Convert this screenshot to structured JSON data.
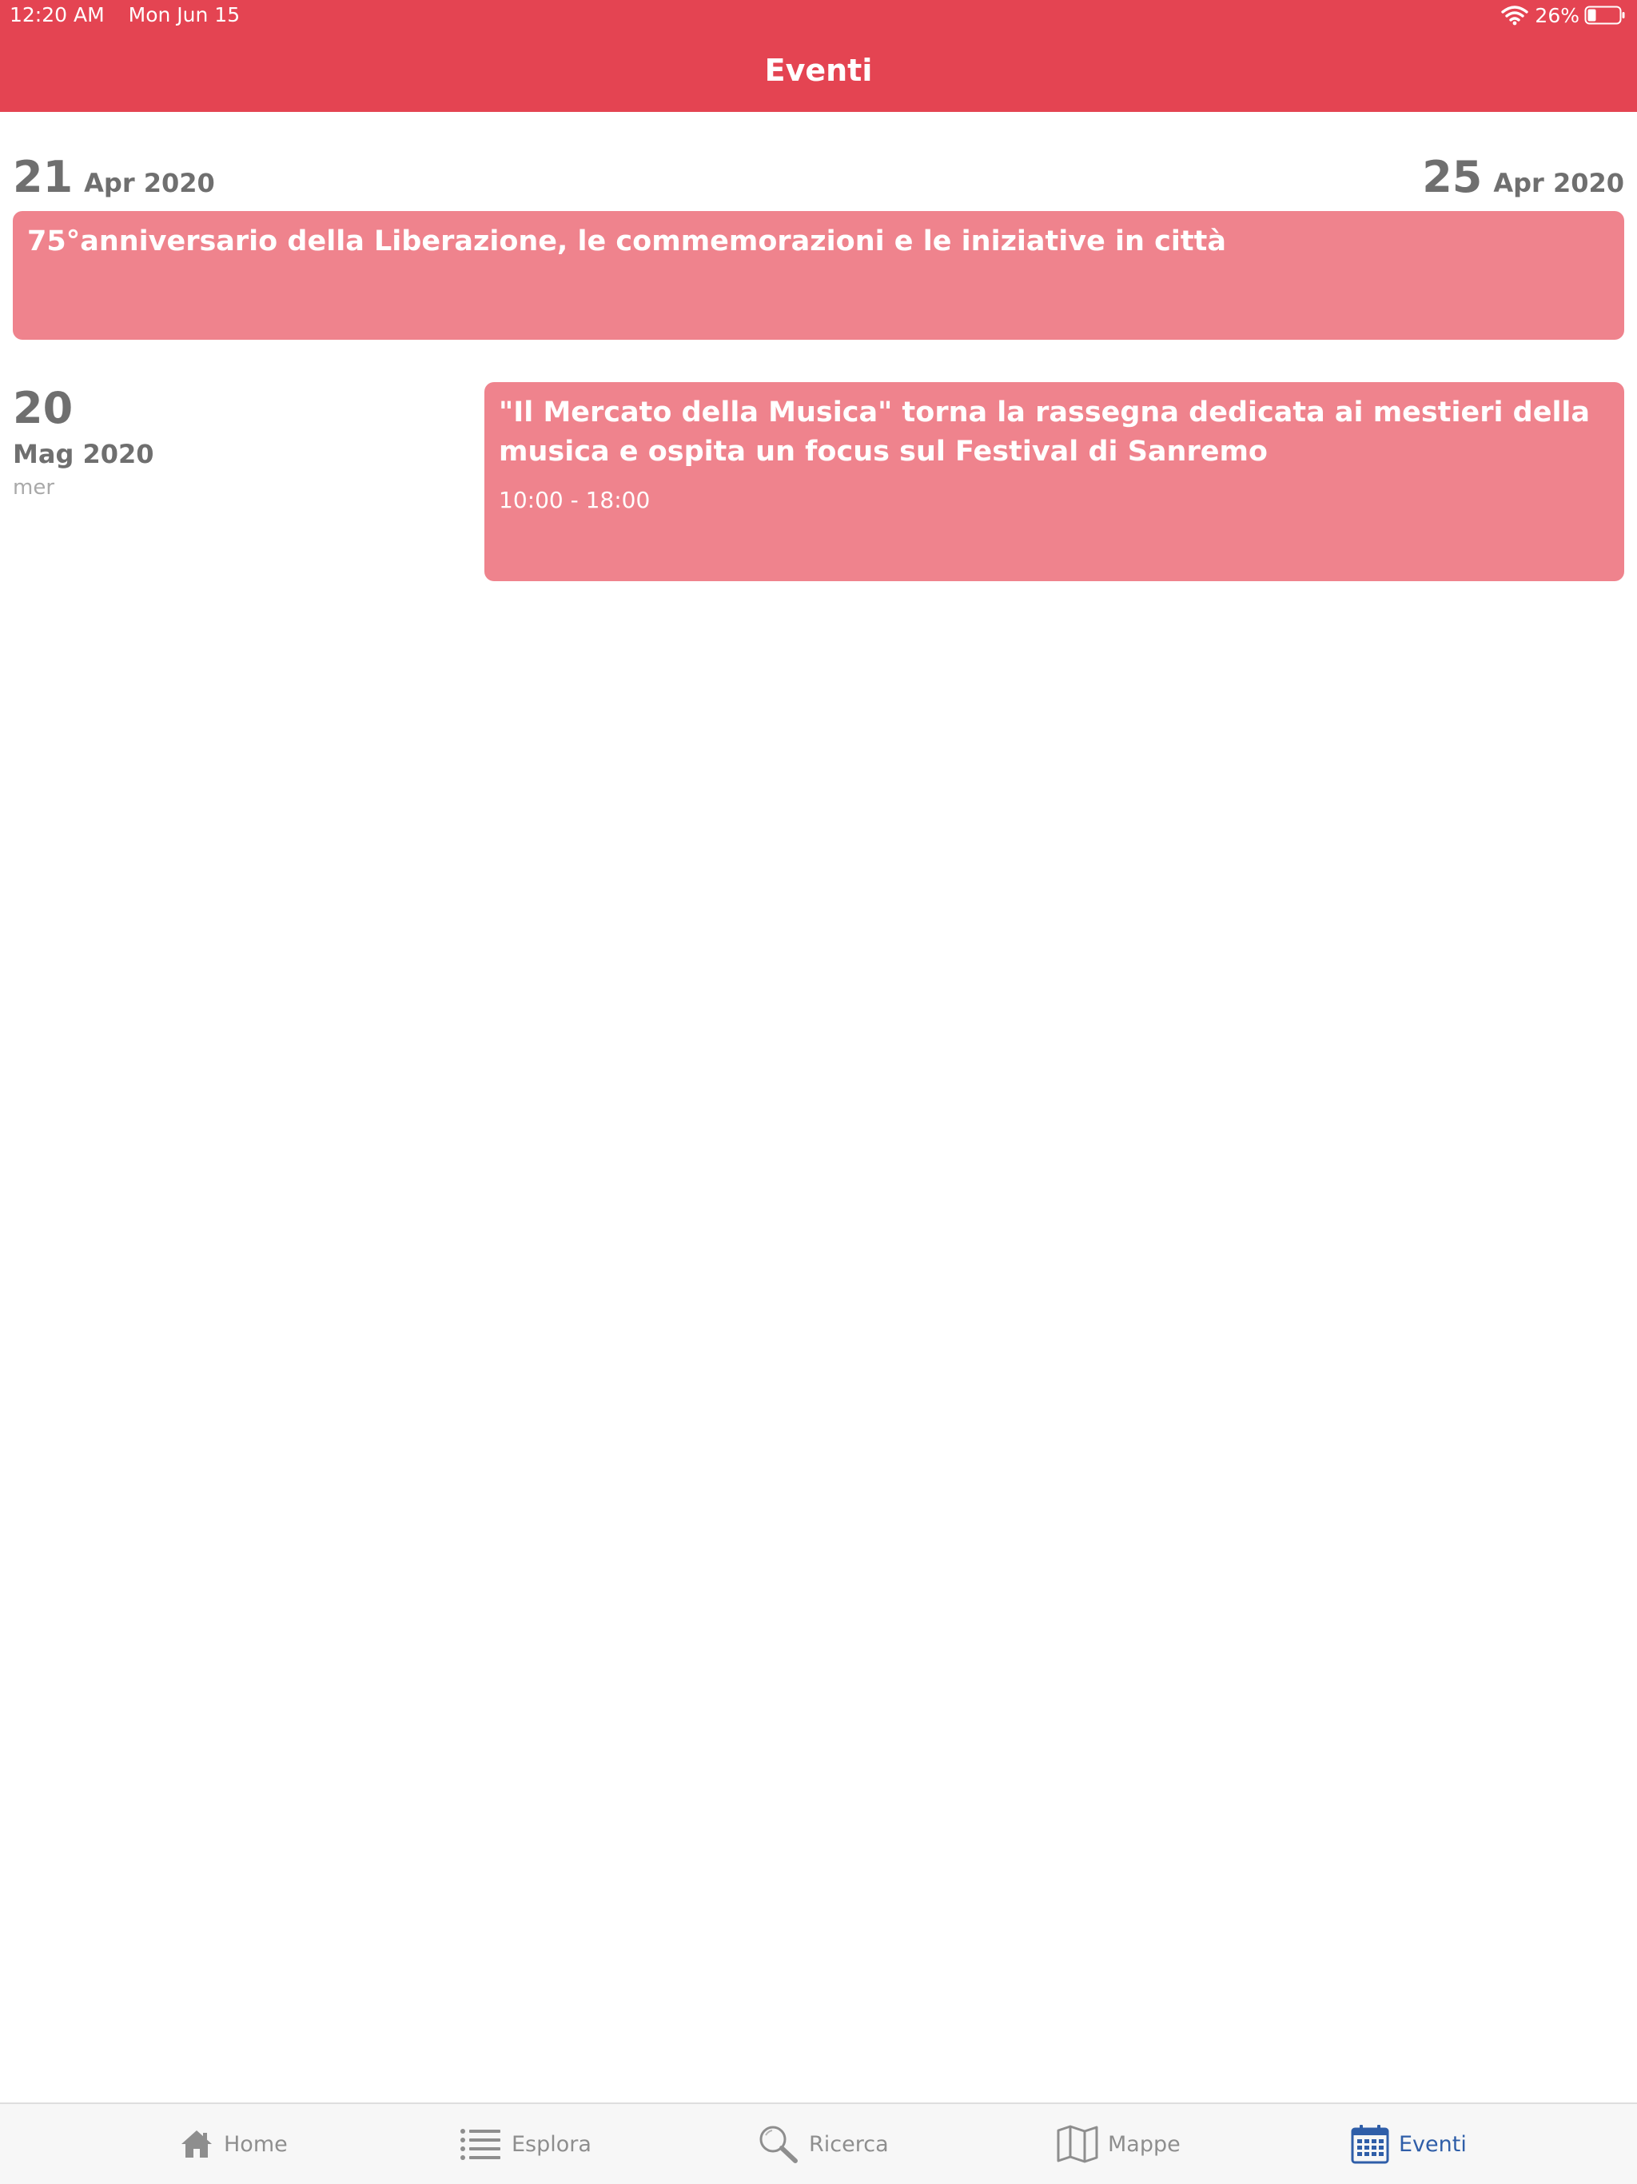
{
  "status_bar": {
    "time": "12:20 AM",
    "date": "Mon Jun 15",
    "battery": "26%"
  },
  "nav": {
    "title": "Eventi"
  },
  "events": [
    {
      "start_day": "21",
      "start_month": "Apr 2020",
      "end_day": "25",
      "end_month": "Apr 2020",
      "title": "75°anniversario della Liberazione, le commemorazioni e le iniziative in città"
    },
    {
      "day": "20",
      "month": "Mag 2020",
      "weekday": "mer",
      "title": "\"Il Mercato della Musica\" torna la rassegna dedicata ai mestieri della musica e ospita un focus sul Festival di Sanremo",
      "time": "10:00 - 18:00"
    }
  ],
  "tabs": [
    {
      "label": "Home",
      "icon": "home-icon"
    },
    {
      "label": "Esplora",
      "icon": "list-icon"
    },
    {
      "label": "Ricerca",
      "icon": "search-icon"
    },
    {
      "label": "Mappe",
      "icon": "map-icon"
    },
    {
      "label": "Eventi",
      "icon": "calendar-icon",
      "active": true
    }
  ],
  "colors": {
    "header": "#e44452",
    "card": "#ef838d",
    "active_tab": "#2f5ea8",
    "inactive_tab": "#8e8e8e"
  }
}
